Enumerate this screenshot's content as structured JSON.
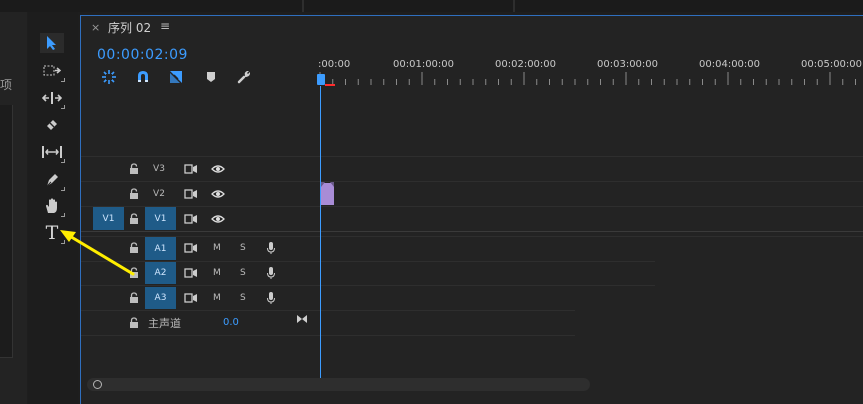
{
  "colors": {
    "accent": "#3c9cff",
    "track_selected": "#1f5b88",
    "clip": "#a88cd6",
    "annotation_arrow": "#ffee00"
  },
  "left_panel": {
    "label": "项"
  },
  "tools": [
    {
      "name": "selection-tool",
      "icon": "arrow-icon"
    },
    {
      "name": "track-select-tool",
      "icon": "track-select-icon"
    },
    {
      "name": "ripple-edit-tool",
      "icon": "ripple-edit-icon"
    },
    {
      "name": "razor-tool",
      "icon": "razor-icon"
    },
    {
      "name": "slip-tool",
      "icon": "slip-icon"
    },
    {
      "name": "pen-tool",
      "icon": "pen-icon"
    },
    {
      "name": "hand-tool",
      "icon": "hand-icon"
    },
    {
      "name": "type-tool",
      "icon": "type-icon",
      "label": "T"
    }
  ],
  "sequence": {
    "close": "×",
    "title": "序列 02",
    "menu": "≡",
    "timecode": "00:00:02:09",
    "ruler_labels": [
      ":00:00",
      "00:01:00:00",
      "00:02:00:00",
      "00:03:00:00",
      "00:04:00:00",
      "00:05:00:00"
    ]
  },
  "video_tracks": [
    {
      "name": "V3",
      "source": ""
    },
    {
      "name": "V2",
      "source": ""
    },
    {
      "name": "V1",
      "source": "V1"
    }
  ],
  "audio_tracks": [
    {
      "name": "A1",
      "m": "M",
      "s": "S"
    },
    {
      "name": "A2",
      "m": "M",
      "s": "S"
    },
    {
      "name": "A3",
      "m": "M",
      "s": "S"
    }
  ],
  "master": {
    "label": "主声道",
    "value": "0.0"
  }
}
